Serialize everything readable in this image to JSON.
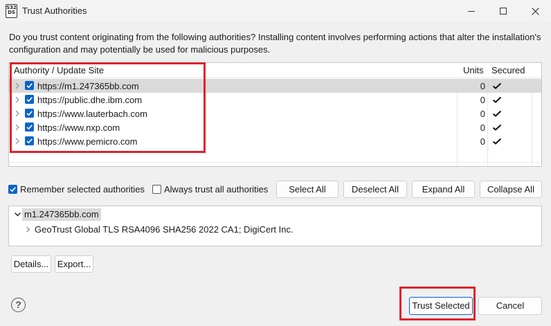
{
  "window": {
    "icon_text": "S32 DS",
    "title": "Trust Authorities",
    "controls": [
      "minimize-icon",
      "maximize-icon",
      "close-icon"
    ]
  },
  "description": "Do you trust content originating from the following authorities?  Installing content involves performing actions that alter the installation's configuration and may potentially be used for malicious purposes.",
  "table": {
    "columns": [
      "Authority / Update Site",
      "Units",
      "Secured"
    ],
    "rows": [
      {
        "site": "https://m1.247365bb.com",
        "units": "0",
        "checked": true,
        "secured": true,
        "selected": true
      },
      {
        "site": "https://public.dhe.ibm.com",
        "units": "0",
        "checked": true,
        "secured": true,
        "selected": false
      },
      {
        "site": "https://www.lauterbach.com",
        "units": "0",
        "checked": true,
        "secured": true,
        "selected": false
      },
      {
        "site": "https://www.nxp.com",
        "units": "0",
        "checked": true,
        "secured": true,
        "selected": false
      },
      {
        "site": "https://www.pemicro.com",
        "units": "0",
        "checked": true,
        "secured": true,
        "selected": false
      }
    ]
  },
  "options": {
    "remember_label": "Remember selected authorities",
    "remember_checked": true,
    "always_trust_label": "Always trust all authorities",
    "always_trust_checked": false
  },
  "actions": {
    "select_all": "Select All",
    "deselect_all": "Deselect All",
    "expand_all": "Expand All",
    "collapse_all": "Collapse All"
  },
  "cert_tree": {
    "root": "m1.247365bb.com",
    "children": [
      "GeoTrust Global TLS RSA4096 SHA256 2022 CA1; DigiCert Inc."
    ]
  },
  "bottom": {
    "details": "Details...",
    "export": "Export...",
    "help_icon": "?",
    "trust_selected": "Trust Selected",
    "cancel": "Cancel"
  },
  "colors": {
    "checkbox_blue": "#0a64c8",
    "highlight_red": "#e0202a",
    "selected_row": "#dadada"
  }
}
